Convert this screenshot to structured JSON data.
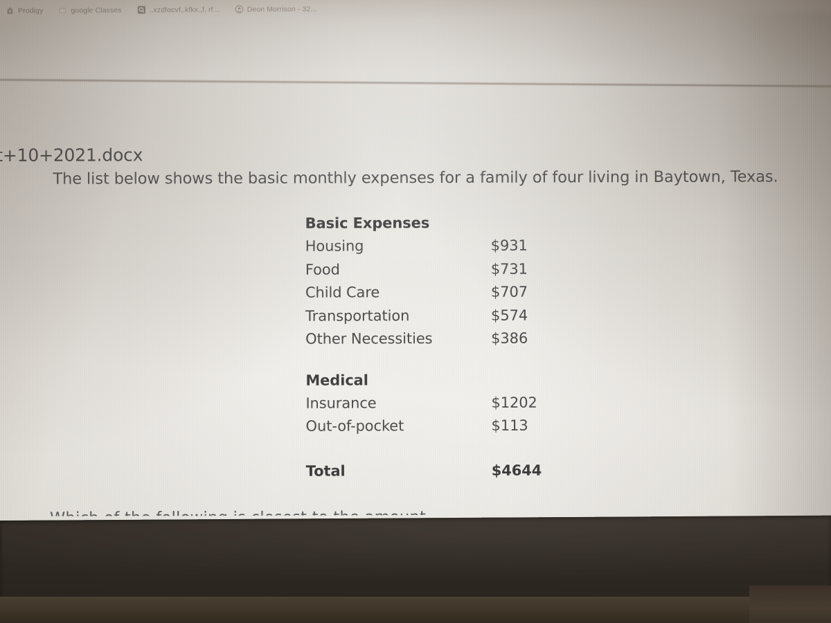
{
  "browser": {
    "bookmarks_bar": {
      "name": "bookmarks-bar",
      "items": [
        {
          "label": "Prodigy",
          "icon": "prodigy-site-icon"
        },
        {
          "label": "google Classes",
          "icon": "classroom-site-icon"
        },
        {
          "label": "..xzdfocvf,.kfkx.,f, rf...",
          "icon": "search-site-icon"
        },
        {
          "label": "Deon Morrison - 32...",
          "icon": "profile-site-icon"
        }
      ]
    }
  },
  "document": {
    "file_title": "t+10+2021.docx",
    "intro_paragraph": "The list below shows the basic monthly expenses for a family of four living in Baytown, Texas.",
    "cutoff_text": "Which of the following is closest to the amount ...",
    "sections": [
      {
        "heading": "Basic Expenses",
        "rows": [
          {
            "label": "Housing",
            "amount": "$931"
          },
          {
            "label": "Food",
            "amount": "$731"
          },
          {
            "label": "Child Care",
            "amount": "$707"
          },
          {
            "label": "Transportation",
            "amount": "$574"
          },
          {
            "label": "Other Necessities",
            "amount": "$386"
          }
        ]
      },
      {
        "heading": "Medical",
        "rows": [
          {
            "label": "Insurance",
            "amount": "$1202"
          },
          {
            "label": "Out-of-pocket",
            "amount": "$113"
          }
        ]
      }
    ],
    "total": {
      "label": "Total",
      "amount": "$4644"
    }
  },
  "colors": {
    "screen_paper": "#f2f0ec",
    "text_body": "#4b4b4b",
    "text_heading": "#3f3f3f",
    "bookmark_text": "#4e463d",
    "bezel": "#332c26",
    "desk": "#3e3428"
  }
}
